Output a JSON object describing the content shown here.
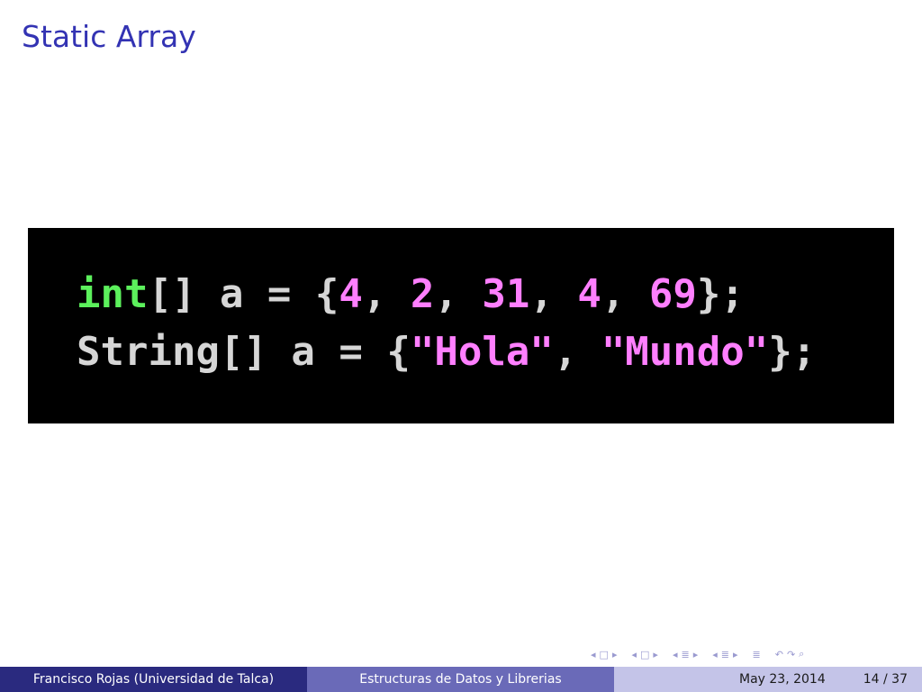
{
  "slide": {
    "title": "Static Array"
  },
  "code": {
    "line1": {
      "keyword": "int",
      "decl": "[] a = {",
      "n1": "4",
      "sep1": ", ",
      "n2": "2",
      "sep2": ", ",
      "n3": "31",
      "sep3": ", ",
      "n4": "4",
      "sep4": ", ",
      "n5": "69",
      "end": "};"
    },
    "line2": {
      "decl": "String[] a = {",
      "s1": "\"Hola\"",
      "sep": ", ",
      "s2": "\"Mundo\"",
      "end": "};"
    },
    "colors": {
      "background": "#000000",
      "keyword": "#5cf05c",
      "literal": "#ff7fff",
      "plain": "#d6d6d6"
    }
  },
  "nav": {
    "icons": [
      "nav-left-arrow-icon",
      "frame-icon",
      "nav-right-arrow-icon",
      "subsection-icon",
      "section-icon",
      "search-icon"
    ],
    "glyphs": {
      "left": "◂",
      "frame": "□",
      "right": "▸",
      "sub": "≣",
      "back": "↶",
      "fwd": "↷",
      "search": "⌕"
    }
  },
  "footer": {
    "author": "Francisco Rojas  (Universidad de Talca)",
    "talk_title": "Estructuras de Datos y Librerias",
    "date": "May 23, 2014",
    "page": "14 / 37"
  },
  "theme": {
    "title_color": "#3333b3",
    "footer_dark": "#2a2a7f",
    "footer_mid": "#6a6ab8",
    "footer_light": "#c4c4e8"
  }
}
